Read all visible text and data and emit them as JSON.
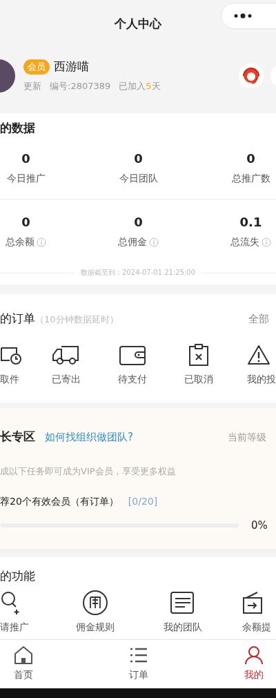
{
  "header": {
    "title": "个人中心"
  },
  "profile": {
    "badge": "会员",
    "name": "西游喵",
    "update": "更新",
    "member_id": "编号:2807389",
    "joined_prefix": "已加入",
    "joined_days": "5",
    "joined_suffix": "天"
  },
  "data_card": {
    "title": "的数据",
    "stats": [
      {
        "value": "0",
        "label": "今日推广",
        "info": false
      },
      {
        "value": "0",
        "label": "今日团队",
        "info": false
      },
      {
        "value": "0",
        "label": "总推广数",
        "info": false
      },
      {
        "value": "0",
        "label": "总余额",
        "info": true
      },
      {
        "value": "0",
        "label": "总佣金",
        "info": true
      },
      {
        "value": "0.1",
        "label": "总流失",
        "info": true
      }
    ],
    "footnote": "数据截至到：2024-07-01 21:25:00"
  },
  "orders": {
    "title": "的订单",
    "note": "（10分钟数据延时）",
    "all_link": "全部",
    "items": [
      {
        "label": "取件"
      },
      {
        "label": "已寄出"
      },
      {
        "label": "待支付"
      },
      {
        "label": "已取消"
      },
      {
        "label": "我的投"
      }
    ]
  },
  "growth": {
    "title": "长专区",
    "help_link": "如何找组织做团队?",
    "level_label": "当前等级",
    "description": "成以下任务即可成为VIP会员，享受更多权益",
    "task": "荐20个有效会员（有订单）",
    "task_count": "[0/20]",
    "level": 0,
    "reading": "0%"
  },
  "functions": {
    "title": "的功能",
    "items": [
      {
        "label": "请推广"
      },
      {
        "label": "佣金规则"
      },
      {
        "label": "我的团队"
      },
      {
        "label": "余额提"
      }
    ]
  },
  "tab_bar": [
    {
      "label": "首页",
      "selected": false
    },
    {
      "label": "订单",
      "selected": false
    },
    {
      "label": "我的",
      "selected": true
    }
  ]
}
